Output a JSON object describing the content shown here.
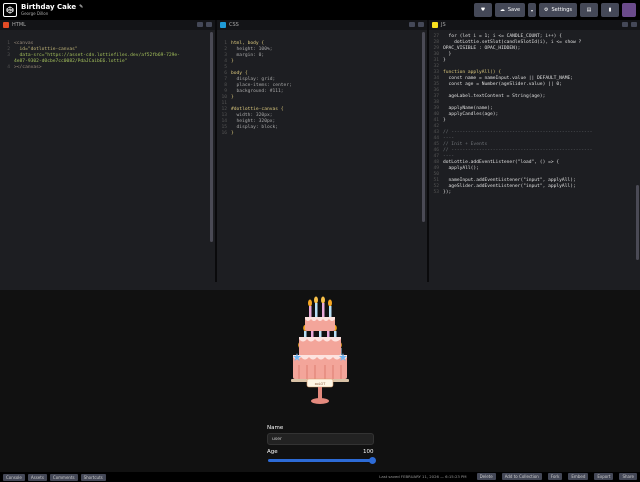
{
  "header": {
    "pen_title": "Birthday Cake",
    "author": "George Dillon",
    "buttons": {
      "save": "Save",
      "settings": "Settings"
    }
  },
  "editors": {
    "html": {
      "label": "HTML"
    },
    "css": {
      "label": "CSS"
    },
    "js": {
      "label": "JS"
    }
  },
  "html_code": [
    "<canvas",
    "  id=\"dotlottie-canvas\"",
    "  data-src=\"https://asset-cdn.lottiefiles.dev/af52fb69-729e-",
    "4e87-9302-d0cbe7cc0082/PdaJCaibE6.lottie\"",
    "></canvas>"
  ],
  "css_code": [
    "html, body {",
    "  height: 100%;",
    "  margin: 0;",
    "}",
    "",
    "body {",
    "  display: grid;",
    "  place-items: center;",
    "  background: #111;",
    "}",
    "",
    "#dotlottie-canvas {",
    "  width: 320px;",
    "  height: 320px;",
    "  display: block;",
    "}"
  ],
  "js_code": [
    {
      "n": "",
      "t": "  for (let i = 1; i <= CANDLE_COUNT; i++) {"
    },
    {
      "n": "",
      "t": "    dotLottie.setSlot(candleSlotId(i), i <= show ?"
    },
    {
      "n": "",
      "t": "OPAC_VISIBLE : OPAC_HIDDEN);"
    },
    {
      "n": "",
      "t": "  }"
    },
    {
      "n": "",
      "t": "}"
    },
    {
      "n": "",
      "t": ""
    },
    {
      "n": "",
      "t": "function applyAll() {"
    },
    {
      "n": "",
      "t": "  const name = nameInput.value || DEFAULT_NAME;"
    },
    {
      "n": "",
      "t": "  const age = Number(ageSlider.value) || 0;"
    },
    {
      "n": "",
      "t": ""
    },
    {
      "n": "",
      "t": "  ageLabel.textContent = String(age);"
    },
    {
      "n": "",
      "t": ""
    },
    {
      "n": "",
      "t": "  applyName(name);"
    },
    {
      "n": "",
      "t": "  applyCandles(age);"
    },
    {
      "n": "",
      "t": "}"
    },
    {
      "n": "",
      "t": ""
    },
    {
      "n": "",
      "t": "// ---------------------------------------------------"
    },
    {
      "n": "",
      "t": "----"
    },
    {
      "n": "",
      "t": "// Init + Events"
    },
    {
      "n": "",
      "t": "// ---------------------------------------------------"
    },
    {
      "n": "",
      "t": "----"
    },
    {
      "n": "",
      "t": "dotLottie.addEventListener(\"load\", () => {"
    },
    {
      "n": "",
      "t": "  applyAll();"
    },
    {
      "n": "",
      "t": ""
    },
    {
      "n": "",
      "t": "  nameInput.addEventListener(\"input\", applyAll);"
    },
    {
      "n": "",
      "t": "  ageSlider.addEventListener(\"input\", applyAll);"
    },
    {
      "n": "",
      "t": "});"
    }
  ],
  "preview": {
    "cake_plate_text": "xoLOT",
    "name_label": "Name",
    "name_value": "user",
    "age_label": "Age",
    "age_value": "100",
    "age_fraction": 1.0
  },
  "footer": {
    "left": [
      "Console",
      "Assets",
      "Comments",
      "Shortcuts"
    ],
    "saved": "Last saved FEBRUARY 11, 2026 — 6:15:23 PM",
    "right": [
      "Delete",
      "Add to Collection",
      "Fork",
      "Embed",
      "Export",
      "Share"
    ]
  },
  "colors": {
    "accent_blue": "#2d6bd6",
    "html_icon": "#e34c26",
    "css_icon": "#1f9bd7",
    "js_icon": "#f7df1e"
  }
}
